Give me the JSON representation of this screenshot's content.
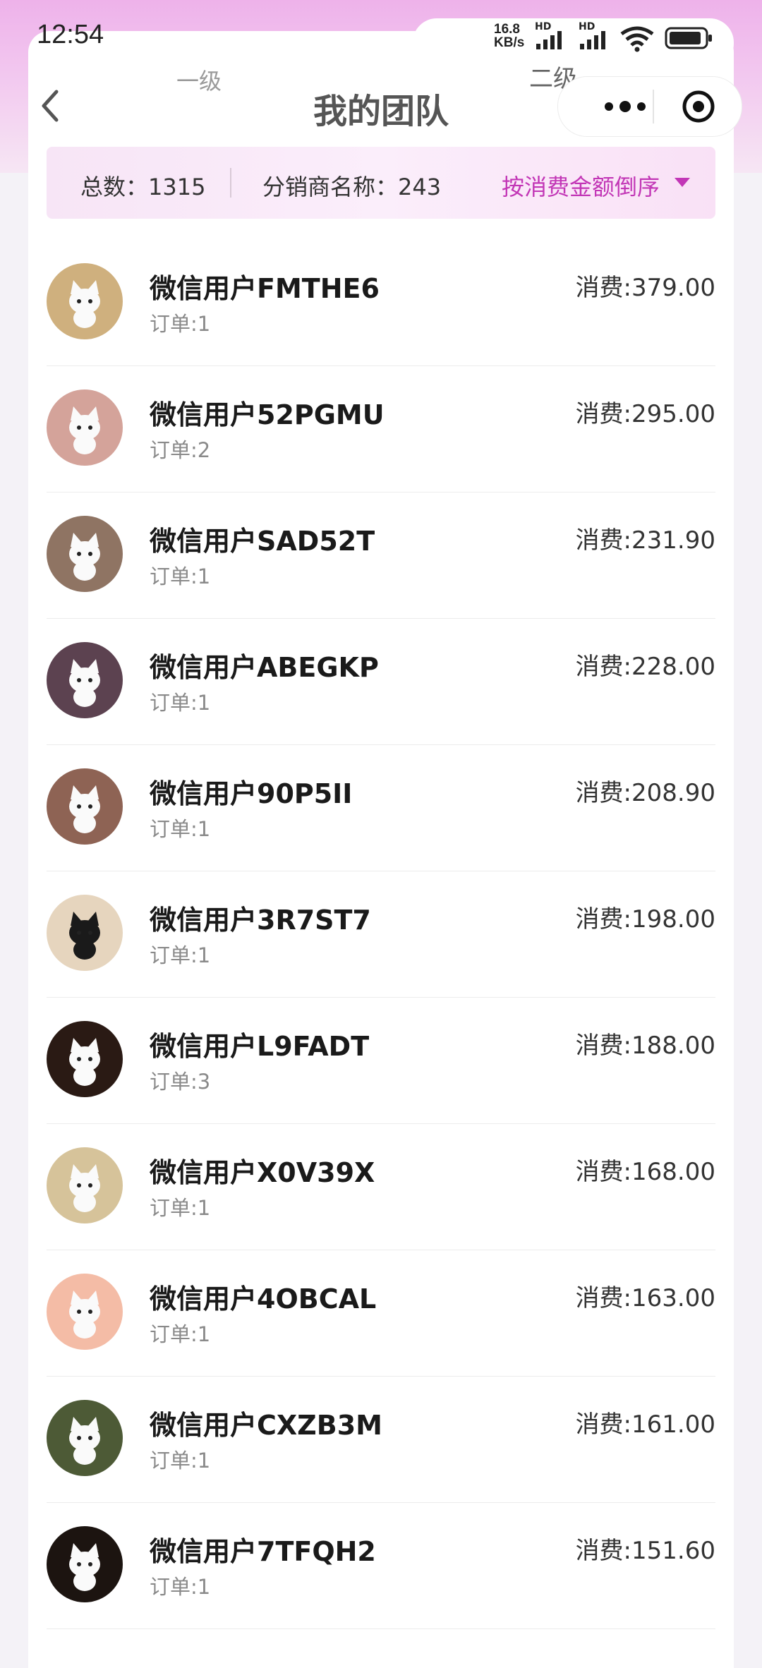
{
  "status_bar": {
    "time": "12:54",
    "net_speed_value": "16.8",
    "net_speed_unit": "KB/s",
    "hd_label_1": "HD",
    "hd_label_2": "HD",
    "battery_icon": "battery-icon",
    "wifi_icon": "wifi-icon",
    "signal_icon": "signal-icon"
  },
  "tabs": {
    "level1": "一级",
    "level2": "二级"
  },
  "nav": {
    "title": "我的团队",
    "back_icon": "chevron-left-icon",
    "more_icon": "more-dots-icon",
    "close_icon": "capsule-close-icon"
  },
  "summary": {
    "total": "总数：1315",
    "distributor": "分销商名称：243",
    "sort": "按消费金额倒序"
  },
  "colors": {
    "accent": "#c236b6",
    "header_gradient_top": "#eeb2ea",
    "summary_bg": "#f9e6f7"
  },
  "members": [
    {
      "name": "微信用户FMTHE6",
      "orders": "订单:1",
      "spend_label": "消费:",
      "spend": "379.00",
      "avatar": "white-cat-avatar",
      "avatar_bg": "#cfb07e"
    },
    {
      "name": "微信用户52PGMU",
      "orders": "订单:2",
      "spend_label": "消费:",
      "spend": "295.00",
      "avatar": "white-cat-avatar",
      "avatar_bg": "#d4a39a"
    },
    {
      "name": "微信用户SAD52T",
      "orders": "订单:1",
      "spend_label": "消费:",
      "spend": "231.90",
      "avatar": "blue-cat-avatar",
      "avatar_bg": "#8f7463"
    },
    {
      "name": "微信用户ABEGKP",
      "orders": "订单:1",
      "spend_label": "消费:",
      "spend": "228.00",
      "avatar": "bowtie-cat-avatar",
      "avatar_bg": "#5c4250"
    },
    {
      "name": "微信用户90P5II",
      "orders": "订单:1",
      "spend_label": "消费:",
      "spend": "208.90",
      "avatar": "sitting-cat-avatar",
      "avatar_bg": "#8e6354"
    },
    {
      "name": "微信用户3R7ST7",
      "orders": "订单:1",
      "spend_label": "消费:",
      "spend": "198.00",
      "avatar": "black-cat-avatar",
      "avatar_bg": "#e6d5be"
    },
    {
      "name": "微信用户L9FADT",
      "orders": "订单:3",
      "spend_label": "消费:",
      "spend": "188.00",
      "avatar": "capybara-avatar",
      "avatar_bg": "#2a1a14"
    },
    {
      "name": "微信用户X0V39X",
      "orders": "订单:1",
      "spend_label": "消费:",
      "spend": "168.00",
      "avatar": "koala-avatar",
      "avatar_bg": "#d6c39a"
    },
    {
      "name": "微信用户4OBCAL",
      "orders": "订单:1",
      "spend_label": "消费:",
      "spend": "163.00",
      "avatar": "laptop-cat-avatar",
      "avatar_bg": "#f4bca6"
    },
    {
      "name": "微信用户CXZB3M",
      "orders": "订单:1",
      "spend_label": "消费:",
      "spend": "161.00",
      "avatar": "deer-forest-avatar",
      "avatar_bg": "#4d5a36"
    },
    {
      "name": "微信用户7TFQH2",
      "orders": "订单:1",
      "spend_label": "消费:",
      "spend": "151.60",
      "avatar": "fox-avatar",
      "avatar_bg": "#1c1410"
    }
  ]
}
